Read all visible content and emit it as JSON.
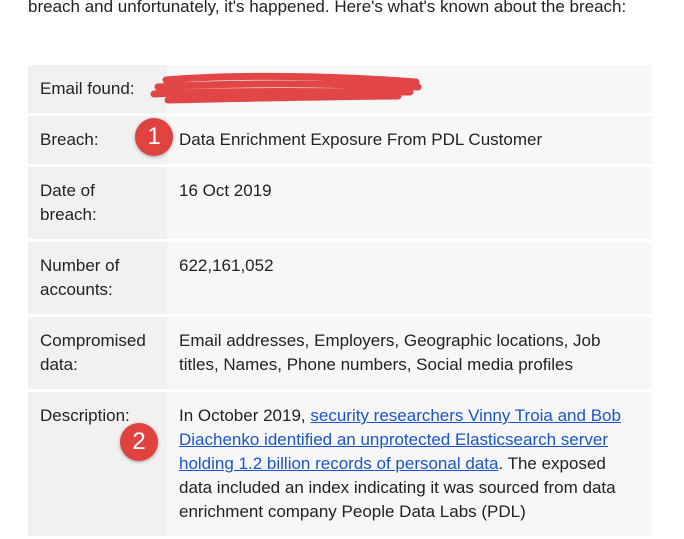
{
  "intro_text": "breach and unfortunately, it's happened. Here's what's known about the breach:",
  "rows": {
    "email": {
      "label": "Email found:",
      "value": ""
    },
    "breach": {
      "label": "Breach:",
      "value": "Data Enrichment Exposure From PDL Customer"
    },
    "date": {
      "label": "Date of breach:",
      "value": "16 Oct 2019"
    },
    "accounts": {
      "label": "Number of accounts:",
      "value": "622,161,052"
    },
    "compromised": {
      "label": "Compromised data:",
      "value": "Email addresses, Employers, Geographic locations, Job titles, Names, Phone numbers, Social media profiles"
    },
    "description": {
      "label": "Description:",
      "prefix": "In October 2019, ",
      "link_text": "security researchers Vinny Troia and Bob Diachenko identified an unprotected Elasticsearch server holding 1.2 billion records of personal data",
      "suffix": ". The exposed data included an index indicating it was sourced from data enrichment company People Data Labs (PDL)"
    }
  },
  "markers": {
    "m1": "1",
    "m2": "2"
  },
  "colors": {
    "marker": "#e0423f",
    "redaction": "#e24545",
    "link": "#1a55c8"
  }
}
